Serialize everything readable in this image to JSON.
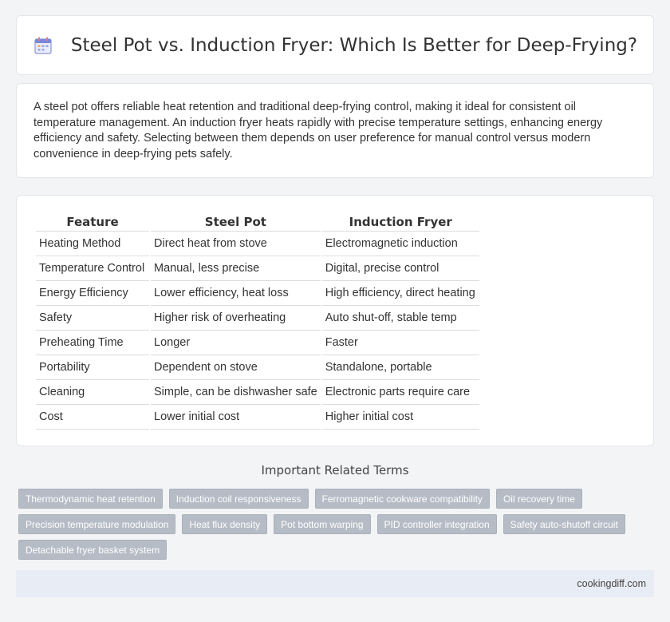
{
  "header": {
    "title": "Steel Pot vs. Induction Fryer: Which Is Better for Deep-Frying?",
    "icon": "calendar-icon"
  },
  "intro": {
    "text": "A steel pot offers reliable heat retention and traditional deep-frying control, making it ideal for consistent oil temperature management. An induction fryer heats rapidly with precise temperature settings, enhancing energy efficiency and safety. Selecting between them depends on user preference for manual control versus modern convenience in deep-frying pets safely."
  },
  "table": {
    "headers": [
      "Feature",
      "Steel Pot",
      "Induction Fryer"
    ],
    "rows": [
      [
        "Heating Method",
        "Direct heat from stove",
        "Electromagnetic induction"
      ],
      [
        "Temperature Control",
        "Manual, less precise",
        "Digital, precise control"
      ],
      [
        "Energy Efficiency",
        "Lower efficiency, heat loss",
        "High efficiency, direct heating"
      ],
      [
        "Safety",
        "Higher risk of overheating",
        "Auto shut-off, stable temp"
      ],
      [
        "Preheating Time",
        "Longer",
        "Faster"
      ],
      [
        "Portability",
        "Dependent on stove",
        "Standalone, portable"
      ],
      [
        "Cleaning",
        "Simple, can be dishwasher safe",
        "Electronic parts require care"
      ],
      [
        "Cost",
        "Lower initial cost",
        "Higher initial cost"
      ]
    ]
  },
  "related": {
    "heading": "Important Related Terms",
    "tags": [
      "Thermodynamic heat retention",
      "Induction coil responsiveness",
      "Ferromagnetic cookware compatibility",
      "Oil recovery time",
      "Precision temperature modulation",
      "Heat flux density",
      "Pot bottom warping",
      "PID controller integration",
      "Safety auto-shutoff circuit",
      "Detachable fryer basket system"
    ]
  },
  "footer": {
    "site": "cookingdiff.com"
  },
  "colors": {
    "tag_bg": "#b5bcc6",
    "footer_bg": "#e8ecf4",
    "page_bg": "#f3f4f6"
  }
}
